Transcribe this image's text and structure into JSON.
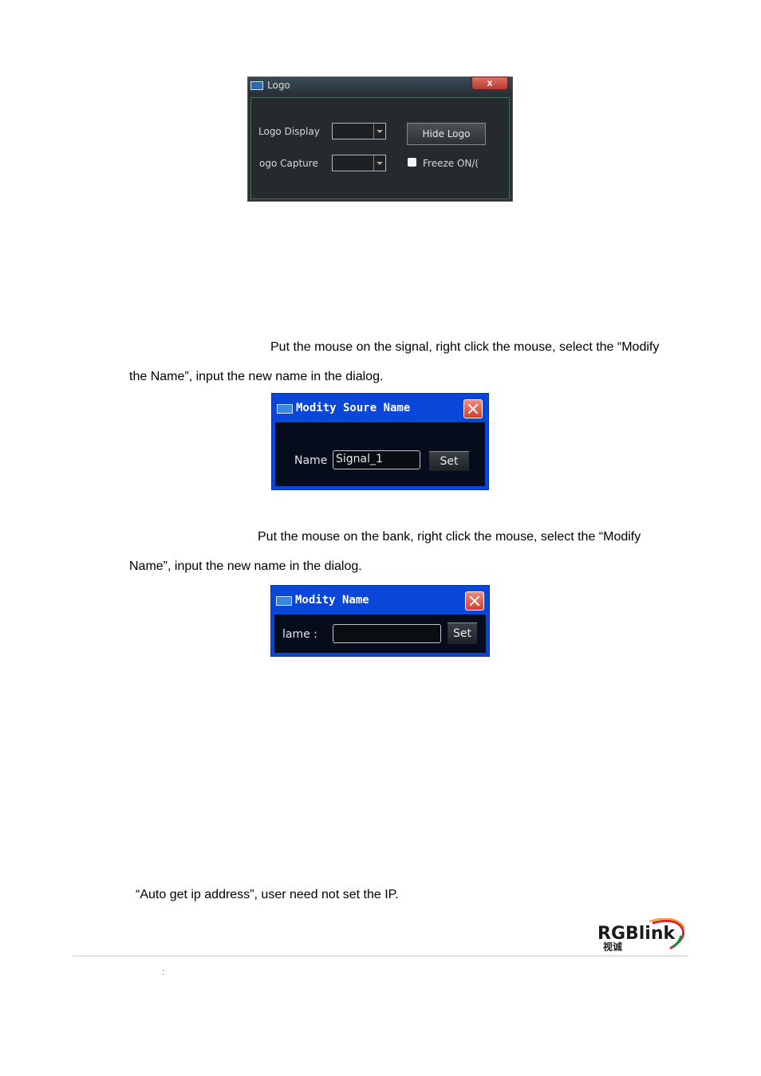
{
  "logo_dialog": {
    "title": "Logo",
    "close_label": "x",
    "display_label": "Logo Display",
    "capture_label": "ogo Capture",
    "display_value": "",
    "capture_value": "",
    "hide_button": "Hide Logo",
    "freeze_label": "Freeze ON/("
  },
  "signal_paragraph": {
    "line1": "Put the mouse on the signal, right click the mouse, select the “Modify",
    "line2": "the Name”, input the new name in the dialog."
  },
  "source_dialog": {
    "title": "Modity Soure Name",
    "name_label": "Name",
    "name_value": "Signal_1",
    "set_button": "Set"
  },
  "bank_paragraph": {
    "line1": "Put the mouse on the bank, right click the mouse, select the “Modify",
    "line2": "Name”, input the new name in the dialog."
  },
  "name_dialog": {
    "title": "Modity Name",
    "name_label": "lame :",
    "name_value": "",
    "set_button": "Set"
  },
  "ip_note": "“Auto get ip address”, user need not set the IP.",
  "footer": {
    "colon": ":",
    "brand_text": "RGBlink",
    "brand_sub": "视诚"
  }
}
